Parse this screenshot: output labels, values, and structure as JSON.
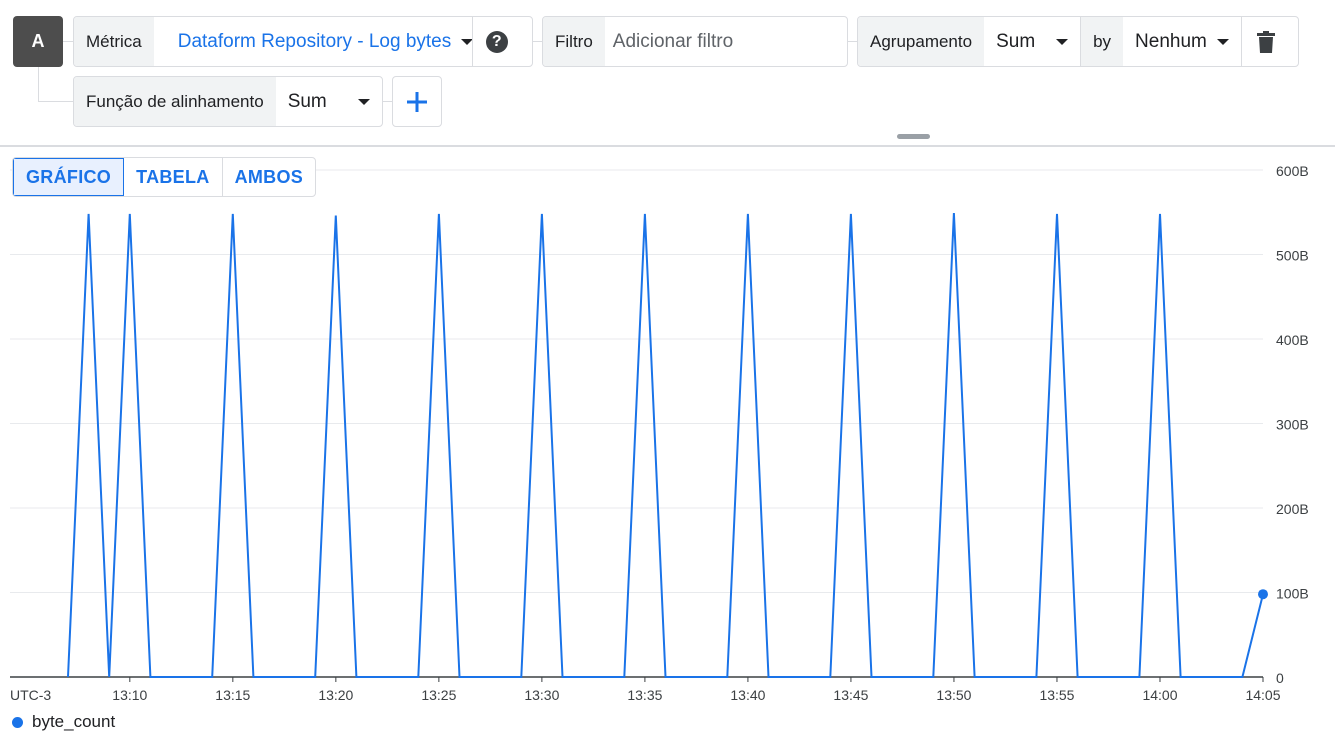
{
  "query": {
    "badge": "A",
    "metric_label": "Métrica",
    "metric_value": "Dataform Repository - Log bytes",
    "filter_label": "Filtro",
    "filter_placeholder": "Adicionar filtro",
    "grouping_label": "Agrupamento",
    "grouping_value": "Sum",
    "by_label": "by",
    "by_value": "Nenhum",
    "alignment_label": "Função de alinhamento",
    "alignment_value": "Sum"
  },
  "view_tabs": [
    "GRÁFICO",
    "TABELA",
    "AMBOS"
  ],
  "active_tab": "GRÁFICO",
  "icons": {
    "help": "help-icon",
    "delete": "trash-icon",
    "add": "plus-icon",
    "dropdown": "caret-down-icon"
  },
  "colors": {
    "accent": "#1a73e8",
    "grid": "#e8eaed",
    "axis": "#3c4043"
  },
  "chart_data": {
    "type": "line",
    "timezone_label": "UTC-3",
    "x_ticks": [
      "13:10",
      "13:15",
      "13:20",
      "13:25",
      "13:30",
      "13:35",
      "13:40",
      "13:45",
      "13:50",
      "13:55",
      "14:00",
      "14:05"
    ],
    "y_ticks": [
      "0",
      "100B",
      "200B",
      "300B",
      "400B",
      "500B",
      "600B"
    ],
    "ylim": [
      0,
      600
    ],
    "y_unit": "B",
    "xlim": [
      "13:07",
      "14:05"
    ],
    "series": [
      {
        "name": "byte_count",
        "color": "#1a73e8",
        "points": [
          [
            "13:07",
            0
          ],
          [
            "13:08",
            548
          ],
          [
            "13:09",
            0
          ],
          [
            "13:10",
            548
          ],
          [
            "13:11",
            0
          ],
          [
            "13:12",
            0
          ],
          [
            "13:13",
            0
          ],
          [
            "13:14",
            0
          ],
          [
            "13:15",
            548
          ],
          [
            "13:16",
            0
          ],
          [
            "13:17",
            0
          ],
          [
            "13:18",
            0
          ],
          [
            "13:19",
            0
          ],
          [
            "13:20",
            546
          ],
          [
            "13:21",
            0
          ],
          [
            "13:22",
            0
          ],
          [
            "13:23",
            0
          ],
          [
            "13:24",
            0
          ],
          [
            "13:25",
            548
          ],
          [
            "13:26",
            0
          ],
          [
            "13:27",
            0
          ],
          [
            "13:28",
            0
          ],
          [
            "13:29",
            0
          ],
          [
            "13:30",
            548
          ],
          [
            "13:31",
            0
          ],
          [
            "13:32",
            0
          ],
          [
            "13:33",
            0
          ],
          [
            "13:34",
            0
          ],
          [
            "13:35",
            548
          ],
          [
            "13:36",
            0
          ],
          [
            "13:37",
            0
          ],
          [
            "13:38",
            0
          ],
          [
            "13:39",
            0
          ],
          [
            "13:40",
            548
          ],
          [
            "13:41",
            0
          ],
          [
            "13:42",
            0
          ],
          [
            "13:43",
            0
          ],
          [
            "13:44",
            0
          ],
          [
            "13:45",
            548
          ],
          [
            "13:46",
            0
          ],
          [
            "13:47",
            0
          ],
          [
            "13:48",
            0
          ],
          [
            "13:49",
            0
          ],
          [
            "13:50",
            549
          ],
          [
            "13:51",
            0
          ],
          [
            "13:52",
            0
          ],
          [
            "13:53",
            0
          ],
          [
            "13:54",
            0
          ],
          [
            "13:55",
            548
          ],
          [
            "13:56",
            0
          ],
          [
            "13:57",
            0
          ],
          [
            "13:58",
            0
          ],
          [
            "13:59",
            0
          ],
          [
            "14:00",
            548
          ],
          [
            "14:01",
            0
          ],
          [
            "14:02",
            0
          ],
          [
            "14:03",
            0
          ],
          [
            "14:04",
            0
          ],
          [
            "14:05",
            98
          ]
        ]
      }
    ],
    "legend": [
      "byte_count"
    ],
    "grid": true
  }
}
